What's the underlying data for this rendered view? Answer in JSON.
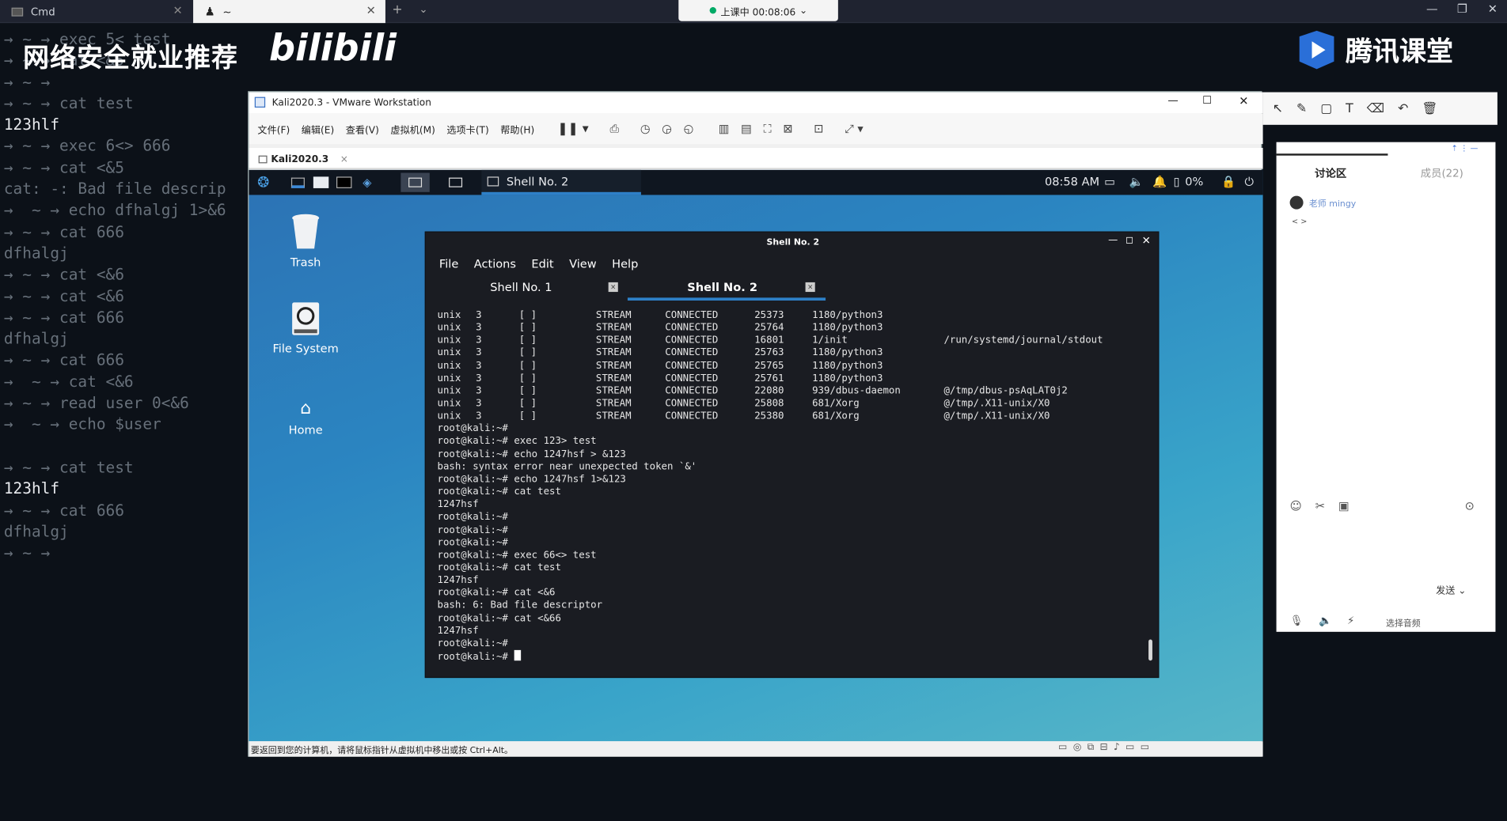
{
  "host": {
    "tabs": [
      {
        "label": "Cmd"
      },
      {
        "label": "~"
      }
    ],
    "new_tab": "+",
    "recording": {
      "label": "上课中 00:08:06",
      "caret": "⌄"
    },
    "window_controls": {
      "minimize": "—",
      "maximize": "❐",
      "close": "✕"
    },
    "watermark": "网络安全就业推荐",
    "bilibili": "bilibili",
    "tencent": "腾讯课堂",
    "terminal_lines": [
      {
        "text": "→ ~ → exec 5< test",
        "hl": false
      },
      {
        "text": "→ ~ → cat <&5",
        "hl": false
      },
      {
        "text": "→ ~ →",
        "hl": false
      },
      {
        "text": "→ ~ → cat test",
        "hl": false
      },
      {
        "text": "123hlf",
        "hl": true
      },
      {
        "text": "→ ~ → exec 6<> 666",
        "hl": false
      },
      {
        "text": "→ ~ → cat <&5",
        "hl": false
      },
      {
        "text": "cat: -: Bad file descrip",
        "hl": false
      },
      {
        "text": "→  ~ → echo dfhalgj 1>&6",
        "hl": false
      },
      {
        "text": "→ ~ → cat 666",
        "hl": false
      },
      {
        "text": "dfhalgj",
        "hl": false
      },
      {
        "text": "→ ~ → cat <&6",
        "hl": false
      },
      {
        "text": "→ ~ → cat <&6",
        "hl": false
      },
      {
        "text": "→ ~ → cat 666",
        "hl": false
      },
      {
        "text": "dfhalgj",
        "hl": false
      },
      {
        "text": "→ ~ → cat 666",
        "hl": false
      },
      {
        "text": "→  ~ → cat <&6",
        "hl": false
      },
      {
        "text": "→ ~ → read user 0<&6",
        "hl": false
      },
      {
        "text": "→  ~ → echo $user",
        "hl": false
      },
      {
        "text": "",
        "hl": false
      },
      {
        "text": "→ ~ → cat test",
        "hl": false
      },
      {
        "text": "123hlf",
        "hl": true
      },
      {
        "text": "→ ~ → cat 666",
        "hl": false
      },
      {
        "text": "dfhalgj",
        "hl": false
      },
      {
        "text": "→ ~ →",
        "hl": false
      }
    ]
  },
  "chat": {
    "tab_discussion": "讨论区",
    "tab_members": "成员(22)",
    "message_user": "老师 mingy",
    "message_text": "< >",
    "send_label": "发送",
    "bottom_label": "选择音频"
  },
  "vmware": {
    "title": "Kali2020.3 - VMware Workstation",
    "menu": [
      "文件(F)",
      "编辑(E)",
      "查看(V)",
      "虚拟机(M)",
      "选项卡(T)",
      "帮助(H)"
    ],
    "tab": "Kali2020.3",
    "status": "要返回到您的计算机，请将鼠标指针从虚拟机中移出或按 Ctrl+Alt。"
  },
  "kali": {
    "taskbar_item": "Shell No. 2",
    "clock": "08:58 AM",
    "battery": "0%",
    "desktop_icons": [
      {
        "label": "Trash"
      },
      {
        "label": "File System"
      },
      {
        "label": "Home"
      }
    ]
  },
  "xterm": {
    "title": "Shell No. 2",
    "menu": [
      "File",
      "Actions",
      "Edit",
      "View",
      "Help"
    ],
    "tab1": "Shell No. 1",
    "tab2": "Shell No. 2",
    "netstat": [
      {
        "proto": "unix",
        "refcnt": "3",
        "flags": "[ ]",
        "type": "STREAM",
        "state": "CONNECTED",
        "inode": "25373",
        "pid": "1180/python3",
        "path": ""
      },
      {
        "proto": "unix",
        "refcnt": "3",
        "flags": "[ ]",
        "type": "STREAM",
        "state": "CONNECTED",
        "inode": "25764",
        "pid": "1180/python3",
        "path": ""
      },
      {
        "proto": "unix",
        "refcnt": "3",
        "flags": "[ ]",
        "type": "STREAM",
        "state": "CONNECTED",
        "inode": "16801",
        "pid": "1/init",
        "path": "/run/systemd/journal/stdout"
      },
      {
        "proto": "unix",
        "refcnt": "3",
        "flags": "[ ]",
        "type": "STREAM",
        "state": "CONNECTED",
        "inode": "25763",
        "pid": "1180/python3",
        "path": ""
      },
      {
        "proto": "unix",
        "refcnt": "3",
        "flags": "[ ]",
        "type": "STREAM",
        "state": "CONNECTED",
        "inode": "25765",
        "pid": "1180/python3",
        "path": ""
      },
      {
        "proto": "unix",
        "refcnt": "3",
        "flags": "[ ]",
        "type": "STREAM",
        "state": "CONNECTED",
        "inode": "25761",
        "pid": "1180/python3",
        "path": ""
      },
      {
        "proto": "unix",
        "refcnt": "3",
        "flags": "[ ]",
        "type": "STREAM",
        "state": "CONNECTED",
        "inode": "22080",
        "pid": "939/dbus-daemon",
        "path": "@/tmp/dbus-psAqLAT0j2"
      },
      {
        "proto": "unix",
        "refcnt": "3",
        "flags": "[ ]",
        "type": "STREAM",
        "state": "CONNECTED",
        "inode": "25808",
        "pid": "681/Xorg",
        "path": "@/tmp/.X11-unix/X0"
      },
      {
        "proto": "unix",
        "refcnt": "3",
        "flags": "[ ]",
        "type": "STREAM",
        "state": "CONNECTED",
        "inode": "25380",
        "pid": "681/Xorg",
        "path": "@/tmp/.X11-unix/X0"
      }
    ],
    "lines": [
      "root@kali:~#",
      "root@kali:~# exec 123> test",
      "root@kali:~# echo 1247hsf > &123",
      "bash: syntax error near unexpected token `&'",
      "root@kali:~# echo 1247hsf 1>&123",
      "root@kali:~# cat test",
      "1247hsf",
      "root@kali:~#",
      "root@kali:~#",
      "root@kali:~#",
      "root@kali:~# exec 66<> test",
      "root@kali:~# cat test",
      "1247hsf",
      "root@kali:~# cat <&6",
      "bash: 6: Bad file descriptor",
      "root@kali:~# cat <&66",
      "1247hsf",
      "root@kali:~#",
      "root@kali:~# "
    ]
  },
  "colors": {
    "host_bg": "#0c1118",
    "kali_panel": "#0f1620",
    "xterm_bg": "#1a1c22",
    "accent": "#2e80c8"
  }
}
